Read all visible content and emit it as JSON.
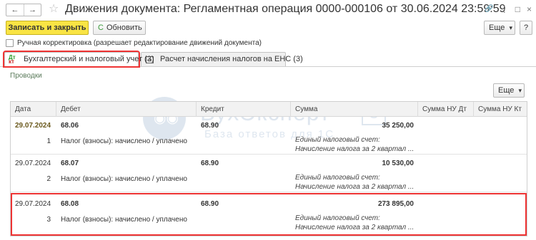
{
  "window": {
    "title": "Движения документа: Регламентная операция 0000-000106 от 30.06.2024 23:59:59",
    "nav_back": "←",
    "nav_forward": "→",
    "star": "☆",
    "link_icon": "🔗",
    "menu_icon": "⋮",
    "maximize_icon": "□",
    "close_icon": "×"
  },
  "toolbar": {
    "save_close_label": "Записать и закрыть",
    "refresh_icon": "C",
    "refresh_label": "Обновить",
    "more_label": "Еще",
    "more_arrow": "▾",
    "help_label": "?"
  },
  "manual_correction": {
    "label": "Ручная корректировка (разрешает редактирование движений документа)",
    "checked": false
  },
  "tabs": [
    {
      "icon_top": "Дт",
      "icon_bottom": "кт",
      "label": "Бухгалтерский и налоговый учет (3)",
      "active": true
    },
    {
      "label": "Расчет начисления налогов на ЕНС (3)",
      "active": false
    }
  ],
  "section": {
    "title": "Проводки",
    "more_label": "Еще",
    "more_arrow": "▾"
  },
  "watermark": {
    "owl": "◉◉",
    "name": "БухЭксперт",
    "digit": "8",
    "subtitle": "База ответов для 1С"
  },
  "table": {
    "columns": [
      "Дата",
      "Дебет",
      "Кредит",
      "Сумма",
      "Сумма НУ Дт",
      "Сумма НУ Кт"
    ],
    "rows": [
      {
        "date": "29.07.2024",
        "num": "1",
        "debit": "68.06",
        "debit_sub": "Налог (взносы): начислено / уплачено",
        "credit": "68.90",
        "amount": "35 250,00",
        "content1": "Единый налоговый счет:",
        "content2": "Начисление налога за 2 квартал ...",
        "nu_dt": "",
        "nu_kt": ""
      },
      {
        "date": "29.07.2024",
        "num": "2",
        "debit": "68.07",
        "debit_sub": "Налог (взносы): начислено / уплачено",
        "credit": "68.90",
        "amount": "10 530,00",
        "content1": "Единый налоговый счет:",
        "content2": "Начисление налога за 2 квартал ...",
        "nu_dt": "",
        "nu_kt": ""
      },
      {
        "date": "29.07.2024",
        "num": "3",
        "debit": "68.08",
        "debit_sub": "Налог (взносы): начислено / уплачено",
        "credit": "68.90",
        "amount": "273 895,00",
        "content1": "Единый налоговый счет:",
        "content2": "Начисление налога за 2 квартал ...",
        "nu_dt": "",
        "nu_kt": ""
      }
    ]
  }
}
